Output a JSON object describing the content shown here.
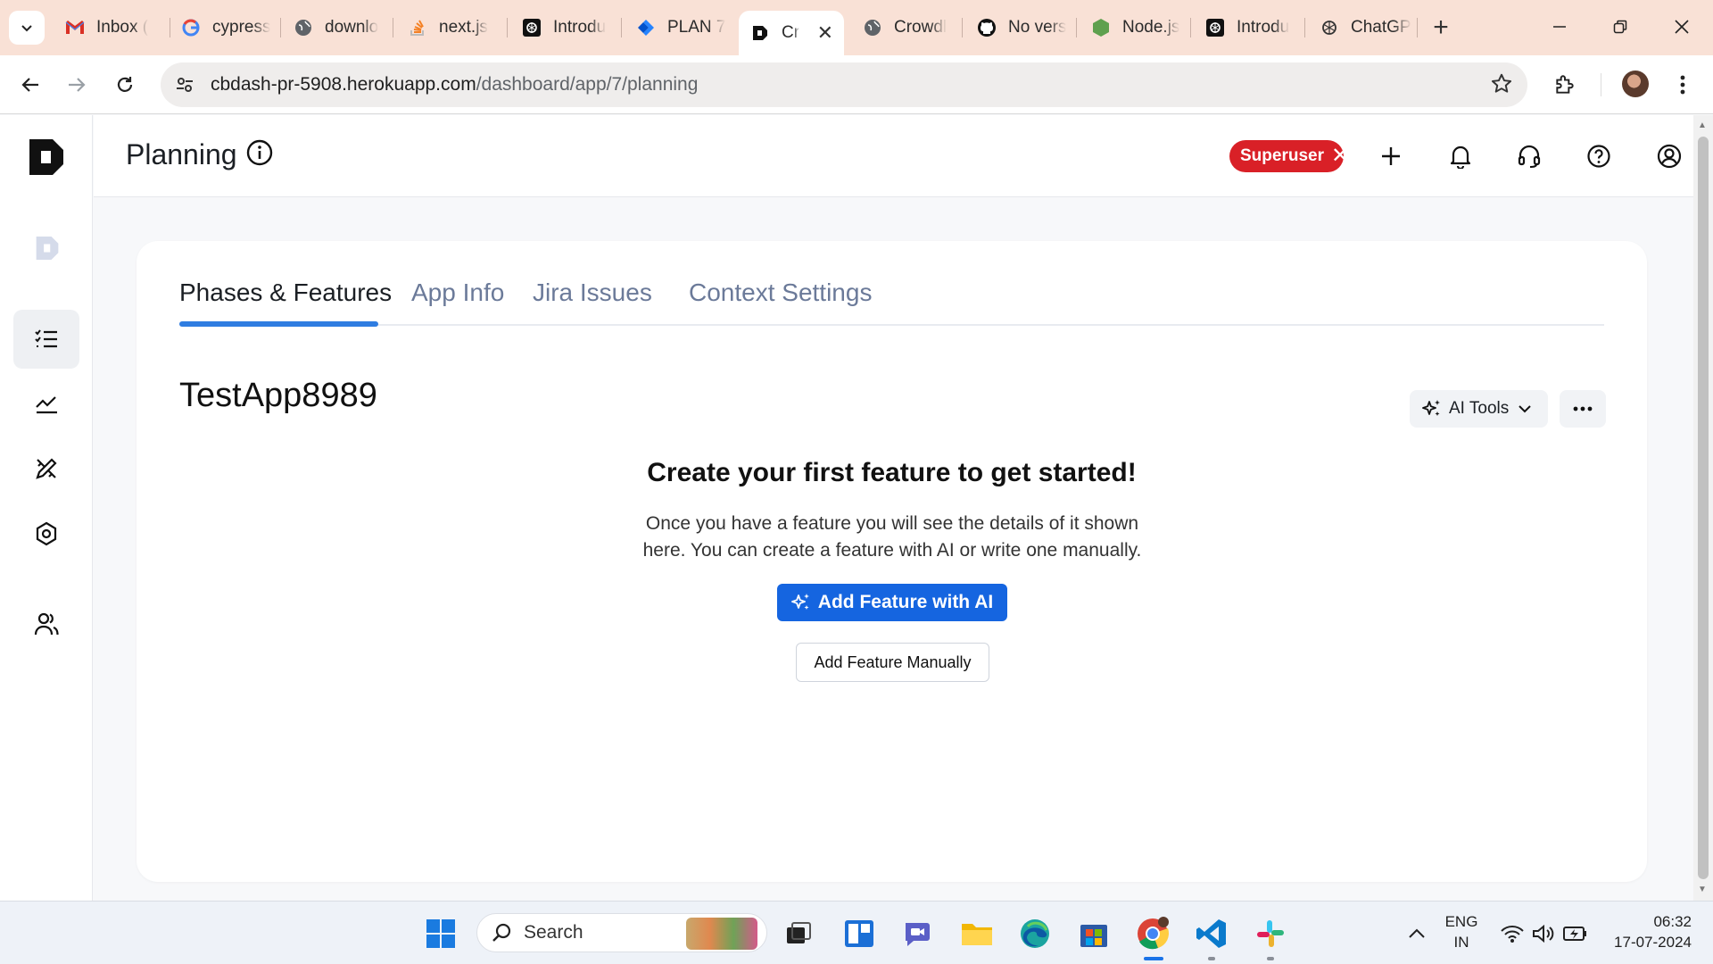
{
  "browser": {
    "tabs": [
      {
        "title": "Inbox (",
        "icon": "gmail-icon"
      },
      {
        "title": "cypress",
        "icon": "google-icon"
      },
      {
        "title": "downlo",
        "icon": "globe-icon"
      },
      {
        "title": "next.js",
        "icon": "stackoverflow-icon"
      },
      {
        "title": "Introdu",
        "icon": "openai-icon"
      },
      {
        "title": "PLAN 7",
        "icon": "jira-icon"
      },
      {
        "title": "Cr",
        "icon": "crowdbotics-icon"
      },
      {
        "title": "Crowdl",
        "icon": "globe-icon"
      },
      {
        "title": "No vers",
        "icon": "github-icon"
      },
      {
        "title": "Node.js",
        "icon": "nodejs-icon"
      },
      {
        "title": "Introdu",
        "icon": "openai-icon"
      },
      {
        "title": "ChatGP",
        "icon": "chatgpt-icon"
      }
    ],
    "active_tab_index": 6,
    "url_host": "cbdash-pr-5908.herokuapp.com",
    "url_path": "/dashboard/app/7/planning"
  },
  "header": {
    "title": "Planning",
    "superuser_label": "Superuser"
  },
  "tabs": {
    "phases": "Phases & Features",
    "app_info": "App Info",
    "jira": "Jira Issues",
    "context": "Context Settings"
  },
  "main": {
    "app_name": "TestApp8989",
    "ai_tools_label": "AI Tools",
    "empty_title": "Create your first feature to get started!",
    "empty_desc": "Once you have a feature you will see the details of it shown here. You can create a feature with AI or write one manually.",
    "add_ai_label": "Add Feature with AI",
    "add_manual_label": "Add Feature Manually"
  },
  "taskbar": {
    "search_label": "Search",
    "lang_line1": "ENG",
    "lang_line2": "IN",
    "time": "06:32",
    "date": "17-07-2024"
  },
  "colors": {
    "accent_blue": "#1565e0",
    "tab_underline": "#2f7de1",
    "superuser_red": "#d92027",
    "tabbar_bg": "#f9e1d6"
  }
}
